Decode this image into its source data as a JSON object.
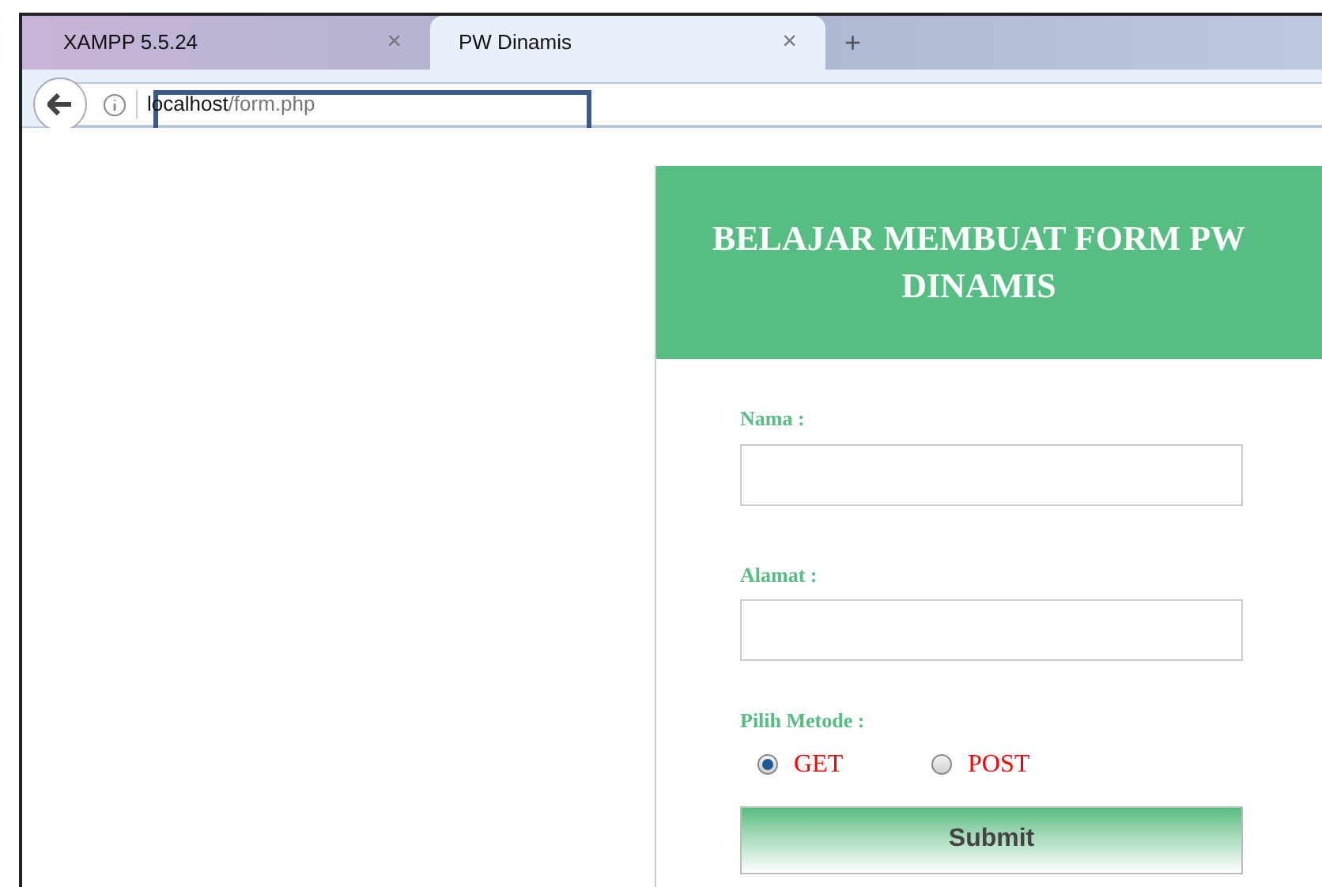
{
  "tabs": [
    {
      "label": "XAMPP 5.5.24",
      "selected": false,
      "close": "×"
    },
    {
      "label": "PW Dinamis",
      "selected": true,
      "close": "×"
    }
  ],
  "new_tab": "+",
  "address": {
    "host": "localhost",
    "path": "/form.php"
  },
  "form": {
    "title": "BELAJAR MEMBUAT FORM PW DINAMIS",
    "fields": [
      {
        "label": "Nama :"
      },
      {
        "label": "Alamat :"
      }
    ],
    "method": {
      "label": "Pilih Metode :",
      "options": [
        {
          "label": "GET",
          "selected": true
        },
        {
          "label": "POST",
          "selected": false
        }
      ]
    },
    "submit": "Submit"
  }
}
